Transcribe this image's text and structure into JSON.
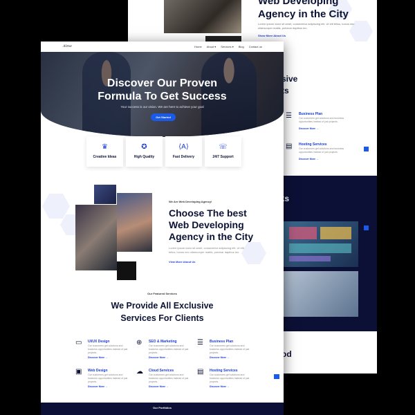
{
  "back_page": {
    "heading_lines": [
      "Web Developing",
      "Agency in the City"
    ],
    "paragraph": "Lorem ipsum dolor sit amet, consectetur adipiscing elit. Ut elit tellus, luctus nec ullamcorper mattis, pulvinar dapibus leo.",
    "link": "Show More About Us",
    "services_title_lines": [
      "sive",
      "ts"
    ],
    "services": [
      {
        "icon": "☰",
        "title": "Business Plan",
        "desc": "Our customers get solutions and business opportunities instead of just projects.",
        "more": "Discover More →"
      },
      {
        "icon": "▤",
        "title": "Hosting Services",
        "desc": "Our customers get solutions and business opportunities instead of just projects.",
        "more": "Discover More →"
      }
    ],
    "works_title": "rks",
    "bottom_text": "od"
  },
  "nav": {
    "logo": "Alme",
    "links": [
      "Home",
      "About ▾",
      "Services ▾",
      "Blog",
      "Contact us"
    ]
  },
  "hero": {
    "title_lines": [
      "Discover Our Proven",
      "Formula To Get Success"
    ],
    "subtitle": "Your success is our vision. We are here to achieve your goal",
    "button": "Get Started"
  },
  "features": [
    {
      "icon": "♛",
      "label": "Creative Ideas"
    },
    {
      "icon": "✪",
      "label": "High Quality"
    },
    {
      "icon": "⟨A⟩",
      "label": "Fast Delivery"
    },
    {
      "icon": "☏",
      "label": "24/7 Support"
    }
  ],
  "about": {
    "kicker": "We Are Web Developing Agency!",
    "title_lines": [
      "Choose The best",
      "Web Developing",
      "Agency in the City"
    ],
    "paragraph": "Lorem ipsum dolor sit amet, consectetur adipiscing elit. Ut elit tellus, luctus nec ullamcorper mattis, pulvinar dapibus leo.",
    "link": "View More About Us"
  },
  "services_section": {
    "kicker": "Our Featured Services",
    "title_lines": [
      "We Provide All Exclusive",
      "Services For Clients"
    ],
    "items": [
      {
        "icon": "▭",
        "title": "UI/UX Design",
        "desc": "Our customers get solutions and business opportunities instead of just projects.",
        "more": "Discover More →"
      },
      {
        "icon": "⊕",
        "title": "SEO & Marketing",
        "desc": "Our customers get solutions and business opportunities instead of just projects.",
        "more": "Discover More →"
      },
      {
        "icon": "☰",
        "title": "Business Plan",
        "desc": "Our customers get solutions and business opportunities instead of just projects.",
        "more": "Discover More →"
      },
      {
        "icon": "▣",
        "title": "Web Design",
        "desc": "Our customers get solutions and business opportunities instead of just projects.",
        "more": "Discover More →"
      },
      {
        "icon": "☁",
        "title": "Cloud Services",
        "desc": "Our customers get solutions and business opportunities instead of just projects.",
        "more": "Discover More →"
      },
      {
        "icon": "▤",
        "title": "Hosting Services",
        "desc": "Our customers get solutions and business opportunities instead of just projects.",
        "more": "Discover More →"
      }
    ]
  },
  "portfolio": {
    "label": "Our Portfolios"
  },
  "colors": {
    "accent": "#1a5ae6",
    "navy": "#0b1233",
    "dark_band": "#0c1036"
  }
}
